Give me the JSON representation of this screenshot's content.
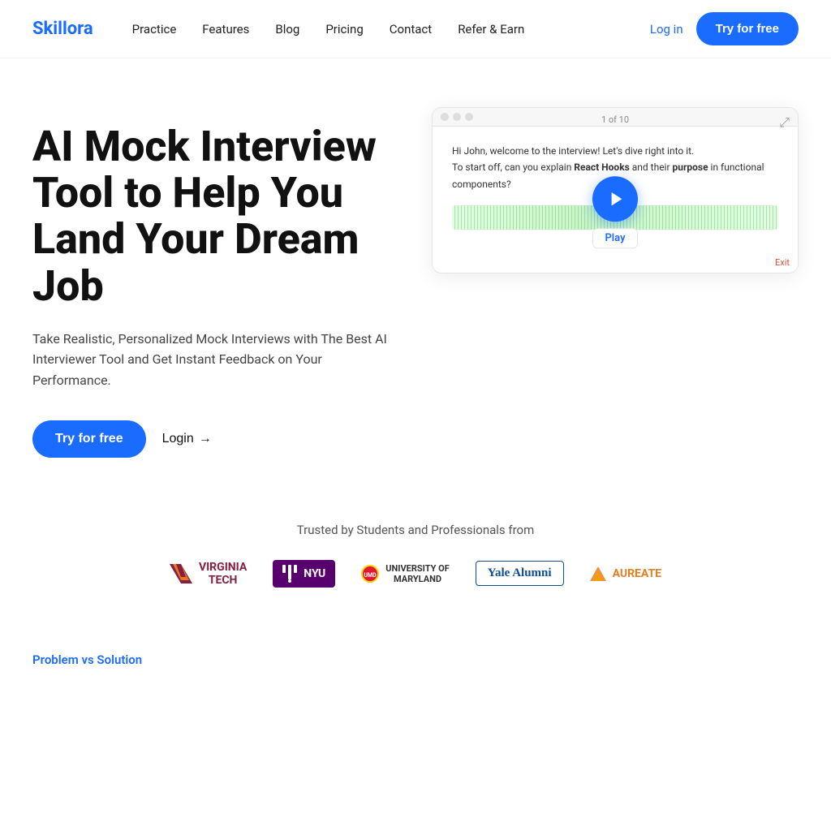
{
  "brand": {
    "name": "Skillora",
    "color": "#1a6bff"
  },
  "nav": {
    "links": [
      {
        "label": "Practice",
        "id": "practice"
      },
      {
        "label": "Features",
        "id": "features"
      },
      {
        "label": "Blog",
        "id": "blog"
      },
      {
        "label": "Pricing",
        "id": "pricing"
      },
      {
        "label": "Contact",
        "id": "contact"
      },
      {
        "label": "Refer & Earn",
        "id": "refer"
      }
    ],
    "login_label": "Log in",
    "cta_label": "Try for free"
  },
  "hero": {
    "title": "AI Mock Interview Tool to Help You Land Your Dream Job",
    "subtitle": "Take Realistic, Personalized Mock Interviews with The Best AI Interviewer Tool and Get Instant Feedback on Your Performance.",
    "cta_label": "Try for free",
    "login_label": "Login",
    "timer": "1:of:10",
    "interview_line1": "Hi John, welcome to the interview! Let's dive right into it.",
    "interview_line2": "To start off, can you explain",
    "interview_bold1": "React Hooks",
    "interview_line3": " and their",
    "interview_bold2": "purpose",
    "interview_line4": " in functional components?",
    "play_label": "Play",
    "exit_label": "Exit"
  },
  "trusted": {
    "title": "Trusted by Students and Professionals from",
    "logos": [
      {
        "name": "Virginia Tech",
        "id": "vt"
      },
      {
        "name": "NYU",
        "id": "nyu"
      },
      {
        "name": "University of Maryland",
        "id": "umd"
      },
      {
        "name": "Yale Alumni",
        "id": "yale"
      },
      {
        "name": "AUREATE",
        "id": "aureate"
      }
    ]
  },
  "problem": {
    "label": "Problem vs Solution"
  }
}
